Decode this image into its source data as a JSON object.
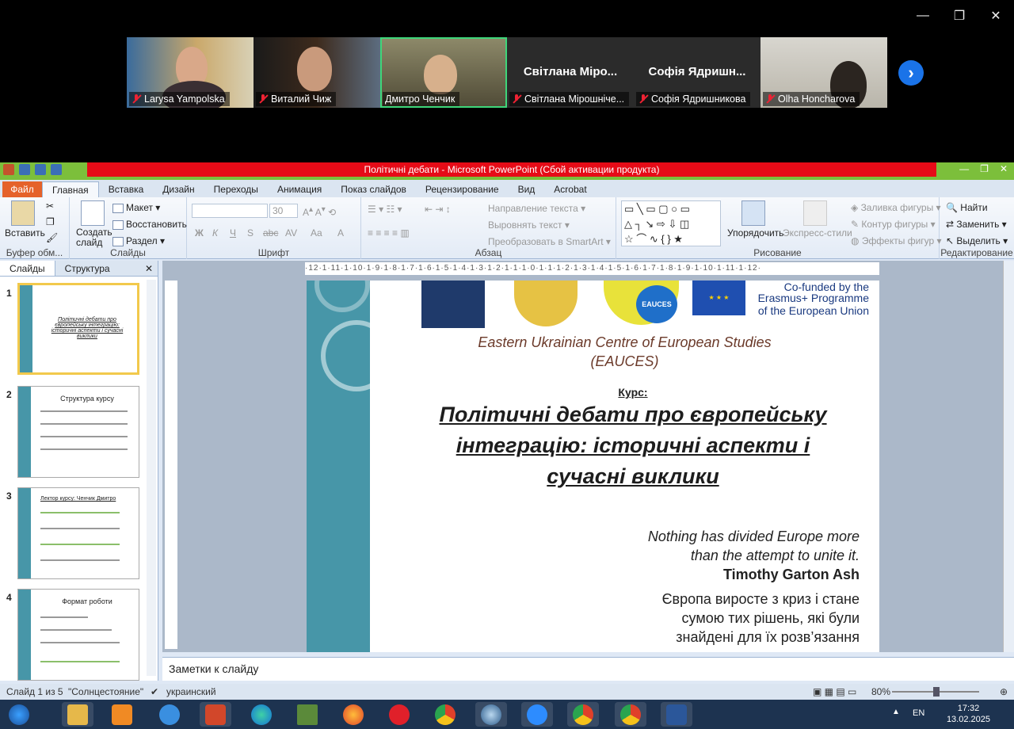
{
  "window_controls": {
    "minimize": "—",
    "restore": "❐",
    "close": "✕"
  },
  "participants": [
    {
      "name": "Larysa Yampolska",
      "video": true,
      "active": false
    },
    {
      "name": "Виталий Чиж",
      "video": true,
      "active": false
    },
    {
      "name": "Дмитро Ченчик",
      "video": true,
      "active": true
    },
    {
      "name": "Світлана Мірошніче...",
      "initials": "Світлана Міро...",
      "video": false,
      "active": false
    },
    {
      "name": "Софія Ядришникова",
      "initials": "Софія Ядришн...",
      "video": false,
      "active": false
    },
    {
      "name": "Olha Honcharova",
      "video": true,
      "active": false
    }
  ],
  "next_participants": "›",
  "ppt": {
    "title": "Політичні дебати  -  Microsoft PowerPoint (Сбой активации продукта)",
    "file_tab": "Файл",
    "tabs": [
      "Главная",
      "Вставка",
      "Дизайн",
      "Переходы",
      "Анимация",
      "Показ слайдов",
      "Рецензирование",
      "Вид",
      "Acrobat"
    ],
    "ribbon": {
      "paste": "Вставить",
      "clipboard_group": "Буфер обм...",
      "new_slide": "Создать слайд",
      "layout": "Макет",
      "reset": "Восстановить",
      "section": "Раздел",
      "slides_group": "Слайды",
      "font_size": "30",
      "font_group": "Шрифт",
      "text_direction": "Направление текста",
      "align_text": "Выровнять текст",
      "smartart": "Преобразовать в SmartArt",
      "paragraph_group": "Абзац",
      "arrange": "Упорядочить",
      "quick_styles": "Экспресс-стили",
      "shape_fill": "Заливка фигуры",
      "shape_outline": "Контур фигуры",
      "shape_effects": "Эффекты фигур",
      "drawing_group": "Рисование",
      "find": "Найти",
      "replace": "Заменить",
      "select": "Выделить",
      "editing_group": "Редактирование"
    },
    "panel_tabs": [
      "Слайды",
      "Структура"
    ],
    "panel_close": "✕",
    "thumbnails": [
      {
        "num": "1",
        "title": "Політичні дебати про європейську інтеграцію: історичні аспекти і сучасні виклики"
      },
      {
        "num": "2",
        "title": "Структура курсу"
      },
      {
        "num": "3",
        "title": "Лектор курсу: Ченчик Дмитро"
      },
      {
        "num": "4",
        "title": "Формат роботи"
      }
    ],
    "ruler": "·12·1·11·1·10·1·9·1·8·1·7·1·6·1·5·1·4·1·3·1·2·1·1·1·0·1·1·1·2·1·3·1·4·1·5·1·6·1·7·1·8·1·9·1·10·1·11·1·12·",
    "slide": {
      "cofunded": "Co-funded by the",
      "erasmus": "Erasmus+ Programme",
      "eu": "of the European Union",
      "eauces_logo": "EAUCES",
      "centre": "Eastern Ukrainian Centre of European Studies",
      "centre_abbr": "(EAUCES)",
      "course_label": "Курс:",
      "course_title_1": "Політичні дебати про європейську",
      "course_title_2": "інтеграцію: історичні аспекти і",
      "course_title_3": "сучасні виклики",
      "quote_1": "Nothing has divided Europe more",
      "quote_2": "than the attempt to unite it.",
      "quote_author": "Timothy Garton Ash",
      "ua_1": "Європа виросте з криз і стане",
      "ua_2": "сумою тих рішень, які були",
      "ua_3": "знайдені для їх розв’язання"
    },
    "notes_placeholder": "Заметки к слайду",
    "status": {
      "slide_of": "Слайд 1 из 5",
      "theme": "\"Солнцестояние\"",
      "language": "украинский",
      "zoom": "80%"
    }
  },
  "taskbar": {
    "lang": "EN",
    "time": "17:32",
    "date": "13.02.2025"
  },
  "colors": {
    "teal": "#4796a8",
    "title_red": "#e60b17",
    "active_tile": "#3ed67a"
  }
}
